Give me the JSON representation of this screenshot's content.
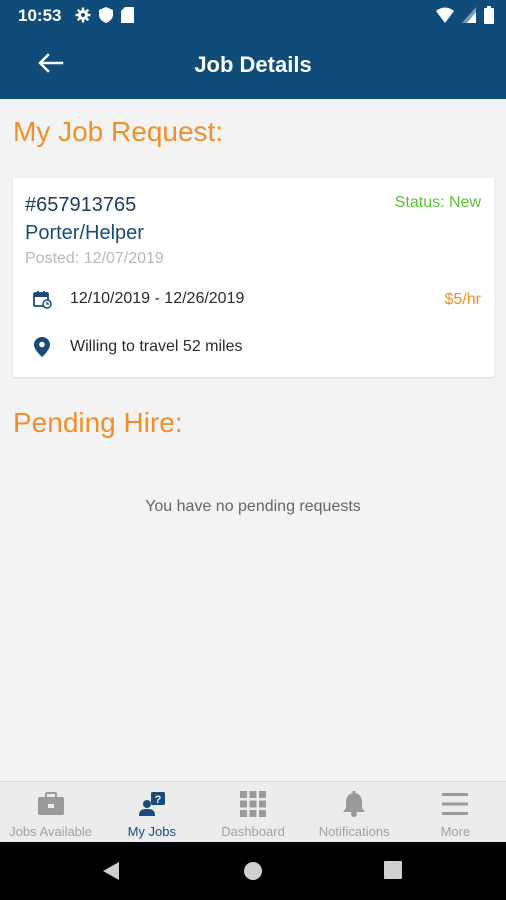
{
  "status_bar": {
    "time": "10:53",
    "left_icons": [
      "gear-icon",
      "shield-icon",
      "sd-card-icon"
    ],
    "right_icons": [
      "wifi-icon",
      "cell-signal-icon",
      "battery-icon"
    ]
  },
  "app_bar": {
    "title": "Job Details",
    "back_icon": "arrow-left-icon"
  },
  "job_request": {
    "section_title": "My Job Request:",
    "job_id": "#657913765",
    "status": "Status: New",
    "job_title": "Porter/Helper",
    "posted": "Posted: 12/07/2019",
    "date_range": "12/10/2019 - 12/26/2019",
    "rate": "$5/hr",
    "travel": "Willing to travel 52 miles"
  },
  "pending_hire": {
    "section_title": "Pending Hire:",
    "empty_message": "You have no pending requests"
  },
  "bottom_nav": {
    "tabs": [
      {
        "label": "Jobs Available",
        "icon": "briefcase-icon",
        "active": false
      },
      {
        "label": "My Jobs",
        "icon": "user-question-icon",
        "active": true
      },
      {
        "label": "Dashboard",
        "icon": "grid-icon",
        "active": false
      },
      {
        "label": "Notifications",
        "icon": "bell-icon",
        "active": false
      },
      {
        "label": "More",
        "icon": "menu-icon",
        "active": false
      }
    ]
  },
  "colors": {
    "primary": "#0f4c7a",
    "accent": "#f0902a",
    "status_new": "#5ac13a",
    "link": "#1a4a7c"
  }
}
